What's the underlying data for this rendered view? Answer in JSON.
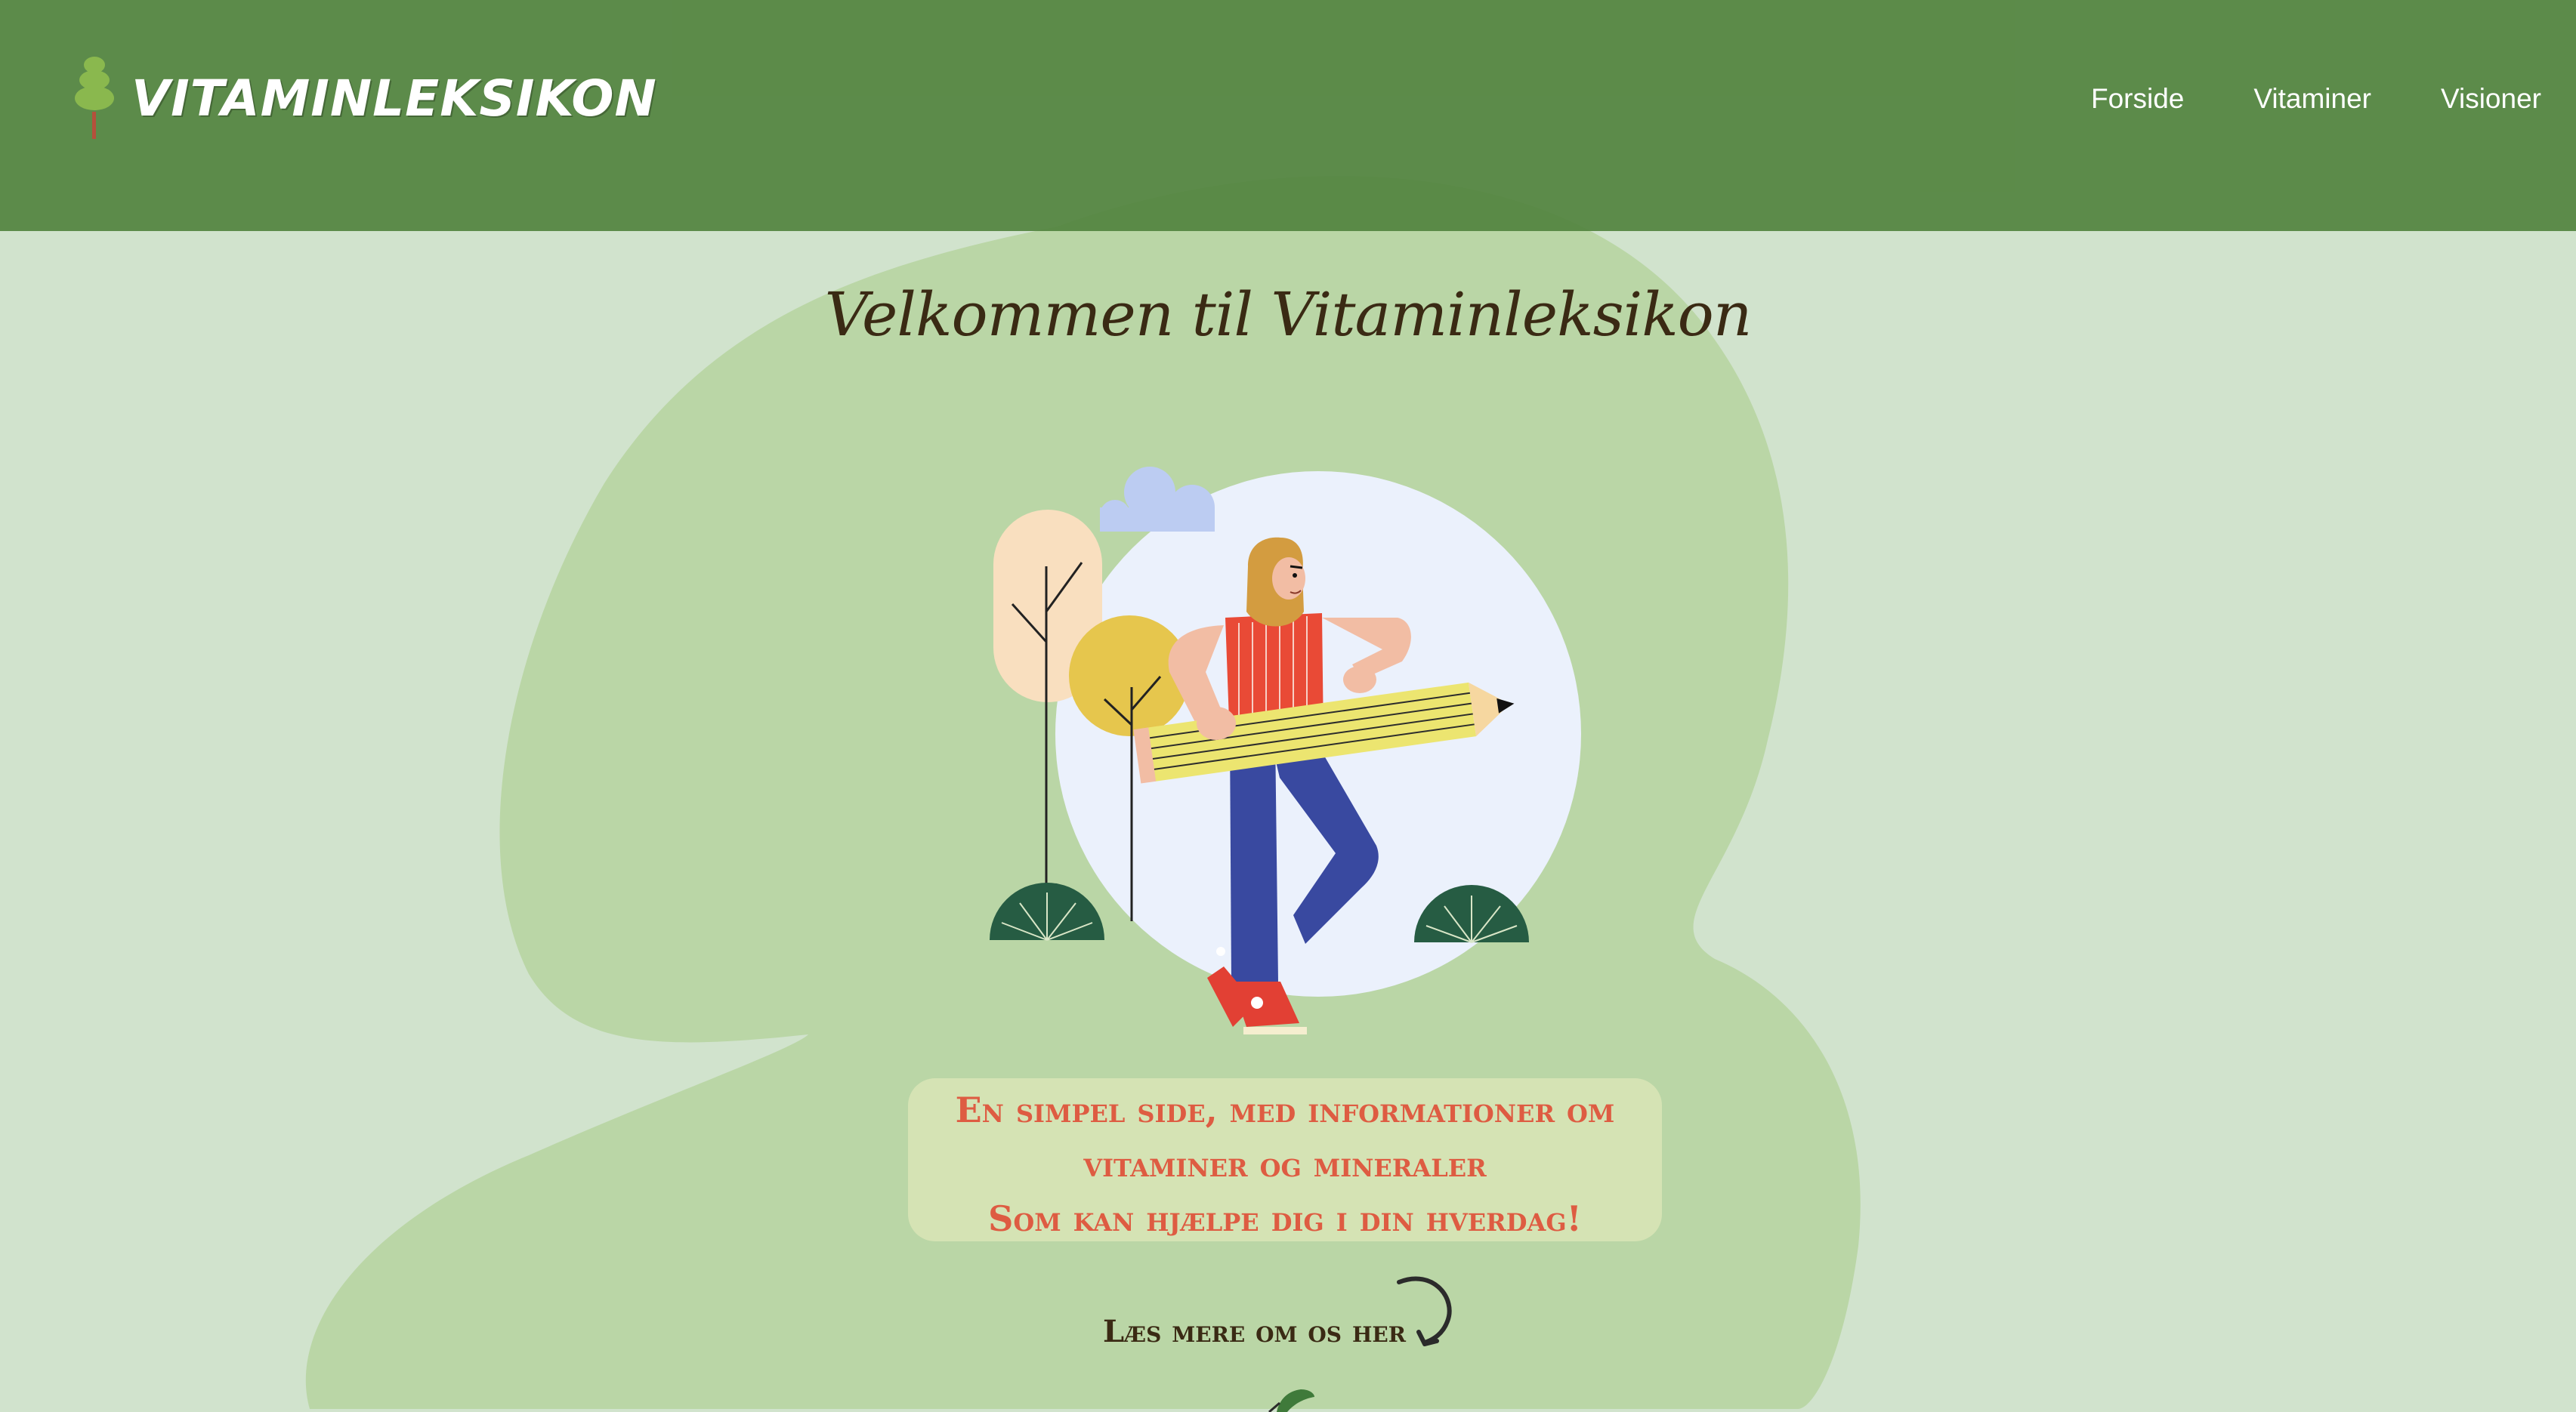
{
  "header": {
    "logo_text": "VITAMINLEKSIKON",
    "logo_icon": "tree-icon",
    "nav": [
      "Forside",
      "Vitaminer",
      "Visioner"
    ]
  },
  "main": {
    "title": "Velkommen til Vitaminleksikon",
    "info_line1": "En simpel side, med informationer om",
    "info_line2": "vitaminer og mineraler",
    "info_line3": "Som kan hjælpe dig i din hverdag!",
    "more_link": "Læs mere om os her",
    "more_icon": "curved-arrow-icon"
  },
  "colors": {
    "background": "#d1e3cd",
    "header": "#53843f",
    "blob": "#bad6a6",
    "accent": "#de5c42",
    "title": "#3a2a14"
  }
}
